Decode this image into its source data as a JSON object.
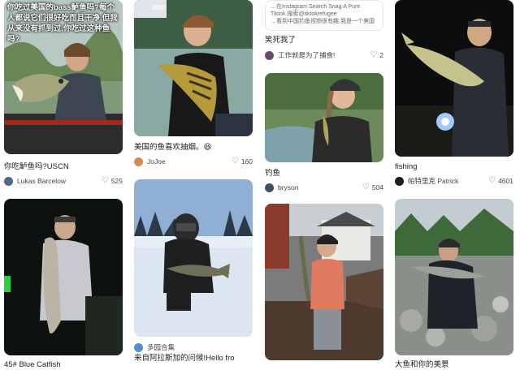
{
  "cards": [
    {
      "overlay": "你吃过美国的bass鲈鱼吗?每个人都说它们很好吃而且干净,但我从来没有抓到过,你吃过这种鱼吗?",
      "caption": "你吃鲈鱼吗?USCN",
      "author": "Lukas Barcelow",
      "likes": "525"
    },
    {
      "caption": "美国的鱼喜欢抽烟。😆",
      "author": "JoJoe",
      "likes": "160"
    },
    {
      "webcard_lines": [
        "…在Instagram Search Snag A Pure",
        "Tiktok 搜索@tiktokrefugee",
        "…看到中国钓鱼视频很有趣,我是一个美国"
      ],
      "caption": "笑死我了",
      "author": "工作就是为了捕食!",
      "likes": "2"
    },
    {
      "caption": "钓鱼",
      "author": "bryson",
      "likes": "504"
    },
    {
      "caption": "fishing",
      "author": "帕特里克 Patrick",
      "likes": "4601"
    },
    {
      "caption": "45# Blue Catfish"
    },
    {
      "author": "多园合集",
      "caption": "来自阿拉斯加的问候!Hello fro"
    },
    {
      "caption": "大鱼和你的美景"
    }
  ]
}
